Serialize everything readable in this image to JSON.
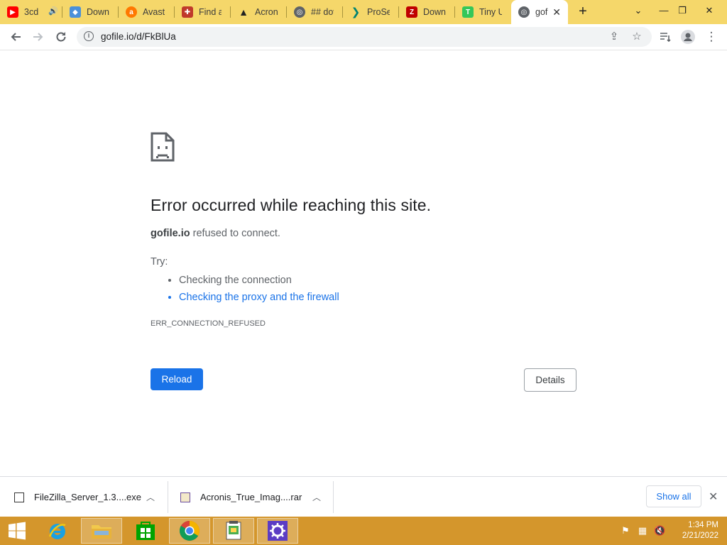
{
  "tabs": [
    {
      "title": "3cd",
      "favicon": "youtube-icon",
      "color": "#ff0000",
      "audio": true
    },
    {
      "title": "Downl",
      "favicon": "map-icon",
      "color": "#4a90d9"
    },
    {
      "title": "Avast |",
      "favicon": "avast-icon",
      "color": "#ff7800"
    },
    {
      "title": "Find an",
      "favicon": "tools-icon",
      "color": "#c0392b"
    },
    {
      "title": "Acronis",
      "favicon": "acronis-icon",
      "color": "#222222"
    },
    {
      "title": "## dov",
      "favicon": "globe-icon",
      "color": "#5f6368"
    },
    {
      "title": "ProSea",
      "favicon": "bing-icon",
      "color": "#008373"
    },
    {
      "title": "Downlo",
      "favicon": "filezilla-icon",
      "color": "#bf0000"
    },
    {
      "title": "Tiny UR",
      "favicon": "tinyurl-icon",
      "color": "#34c759"
    },
    {
      "title": "gof",
      "favicon": "globe-icon",
      "color": "#5f6368",
      "active": true
    }
  ],
  "address_bar": {
    "url": "gofile.io/d/FkBlUa"
  },
  "error": {
    "title": "Error occurred while reaching this site.",
    "host": "gofile.io",
    "message": " refused to connect.",
    "try_label": "Try:",
    "suggestions": [
      "Checking the connection",
      "Checking the proxy and the firewall"
    ],
    "code": "ERR_CONNECTION_REFUSED",
    "reload_label": "Reload",
    "details_label": "Details"
  },
  "downloads": {
    "items": [
      {
        "name": "FileZilla_Server_1.3....exe"
      },
      {
        "name": "Acronis_True_Imag....rar"
      }
    ],
    "show_all_label": "Show all"
  },
  "taskbar": {
    "time": "1:34 PM",
    "date": "2/21/2022"
  },
  "colors": {
    "tab_strip": "#f5d76a",
    "taskbar": "#d4962c",
    "accent": "#1a73e8"
  }
}
